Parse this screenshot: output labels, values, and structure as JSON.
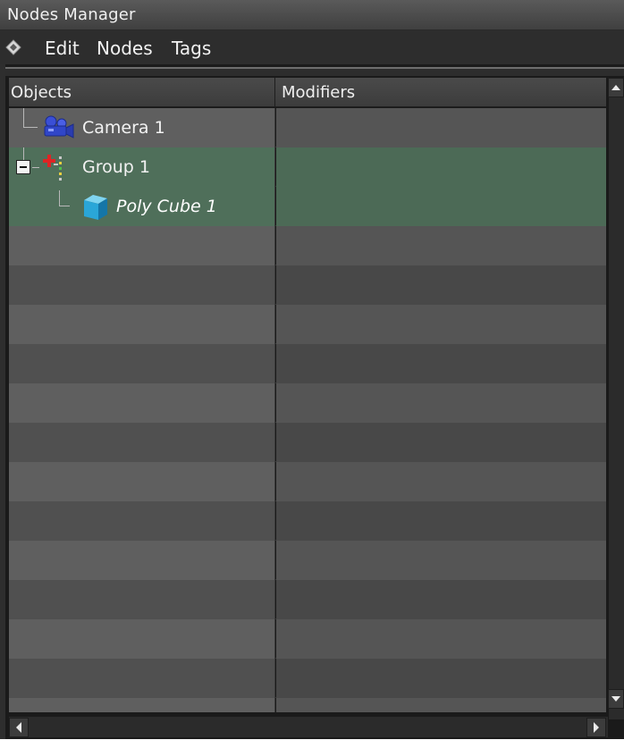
{
  "window": {
    "title": "Nodes Manager"
  },
  "menu": {
    "edit": "Edit",
    "nodes": "Nodes",
    "tags": "Tags"
  },
  "columns": {
    "objects": "Objects",
    "modifiers": "Modifiers"
  },
  "nodes": [
    {
      "label": "Camera 1",
      "icon": "camera-icon"
    },
    {
      "label": "Group 1",
      "icon": "group-icon",
      "expanded": true
    },
    {
      "label": "Poly Cube 1",
      "icon": "cube-icon",
      "selected": true
    }
  ],
  "colors": {
    "selection": "#4f6f5a",
    "row_light": "#5f5f5f",
    "row_dark": "#505050"
  }
}
